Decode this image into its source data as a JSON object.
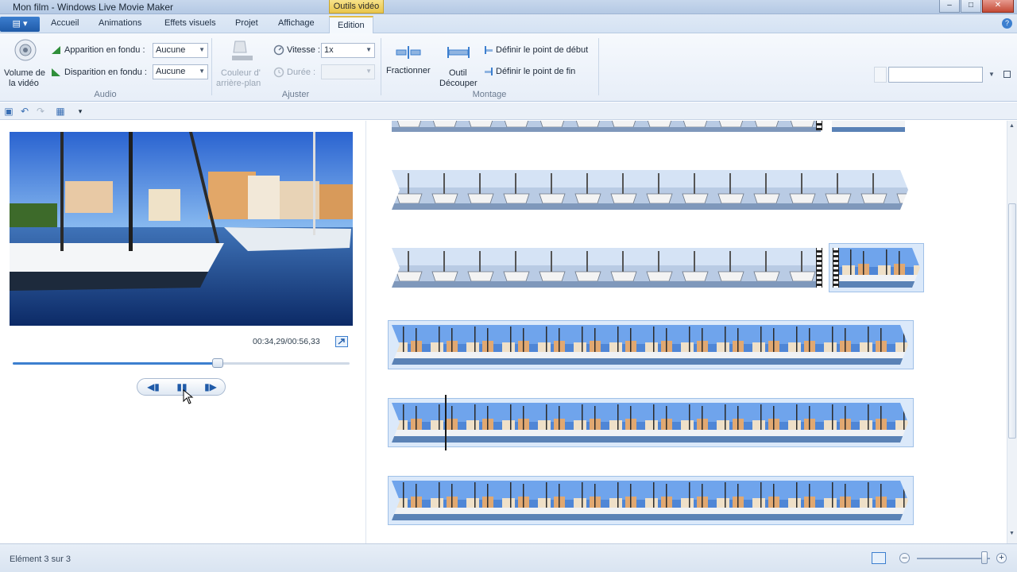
{
  "window": {
    "title": "Mon film - Windows Live Movie Maker",
    "context_tab_header": "Outils vidéo",
    "minimize": "–",
    "maximize": "□",
    "close": "✕"
  },
  "app_menu": {
    "glyph": "▤ ▾"
  },
  "tabs": [
    {
      "label": "Accueil"
    },
    {
      "label": "Animations"
    },
    {
      "label": "Effets visuels"
    },
    {
      "label": "Projet"
    },
    {
      "label": "Affichage"
    },
    {
      "label": "Edition"
    }
  ],
  "help_glyph": "?",
  "ribbon": {
    "audio": {
      "label": "Audio",
      "volume_label_1": "Volume de",
      "volume_label_2": "la vidéo",
      "fade_in_label": "Apparition en fondu :",
      "fade_in_value": "Aucune",
      "fade_out_label": "Disparition en fondu :",
      "fade_out_value": "Aucune"
    },
    "ajuster": {
      "label": "Ajuster",
      "bg_color_label_1": "Couleur d'",
      "bg_color_label_2": "arrière-plan",
      "speed_label": "Vitesse :",
      "speed_value": "1x",
      "duration_label": "Durée :",
      "duration_value": ""
    },
    "montage": {
      "label": "Montage",
      "split_label": "Fractionner",
      "trim_label_1": "Outil",
      "trim_label_2": "Découper",
      "set_start_label": "Définir le point de début",
      "set_end_label": "Définir le point de fin"
    },
    "search_value": ""
  },
  "preview": {
    "time_readout": "00:34,29/00:56,33",
    "progress": 0.6087
  },
  "status": {
    "text": "Elément 3 sur 3",
    "zoom_level": 0.92
  },
  "colors": {
    "accent": "#3c7fcf",
    "selected_clip": "#dbe9fa",
    "context_tab": "#e9c64c"
  }
}
